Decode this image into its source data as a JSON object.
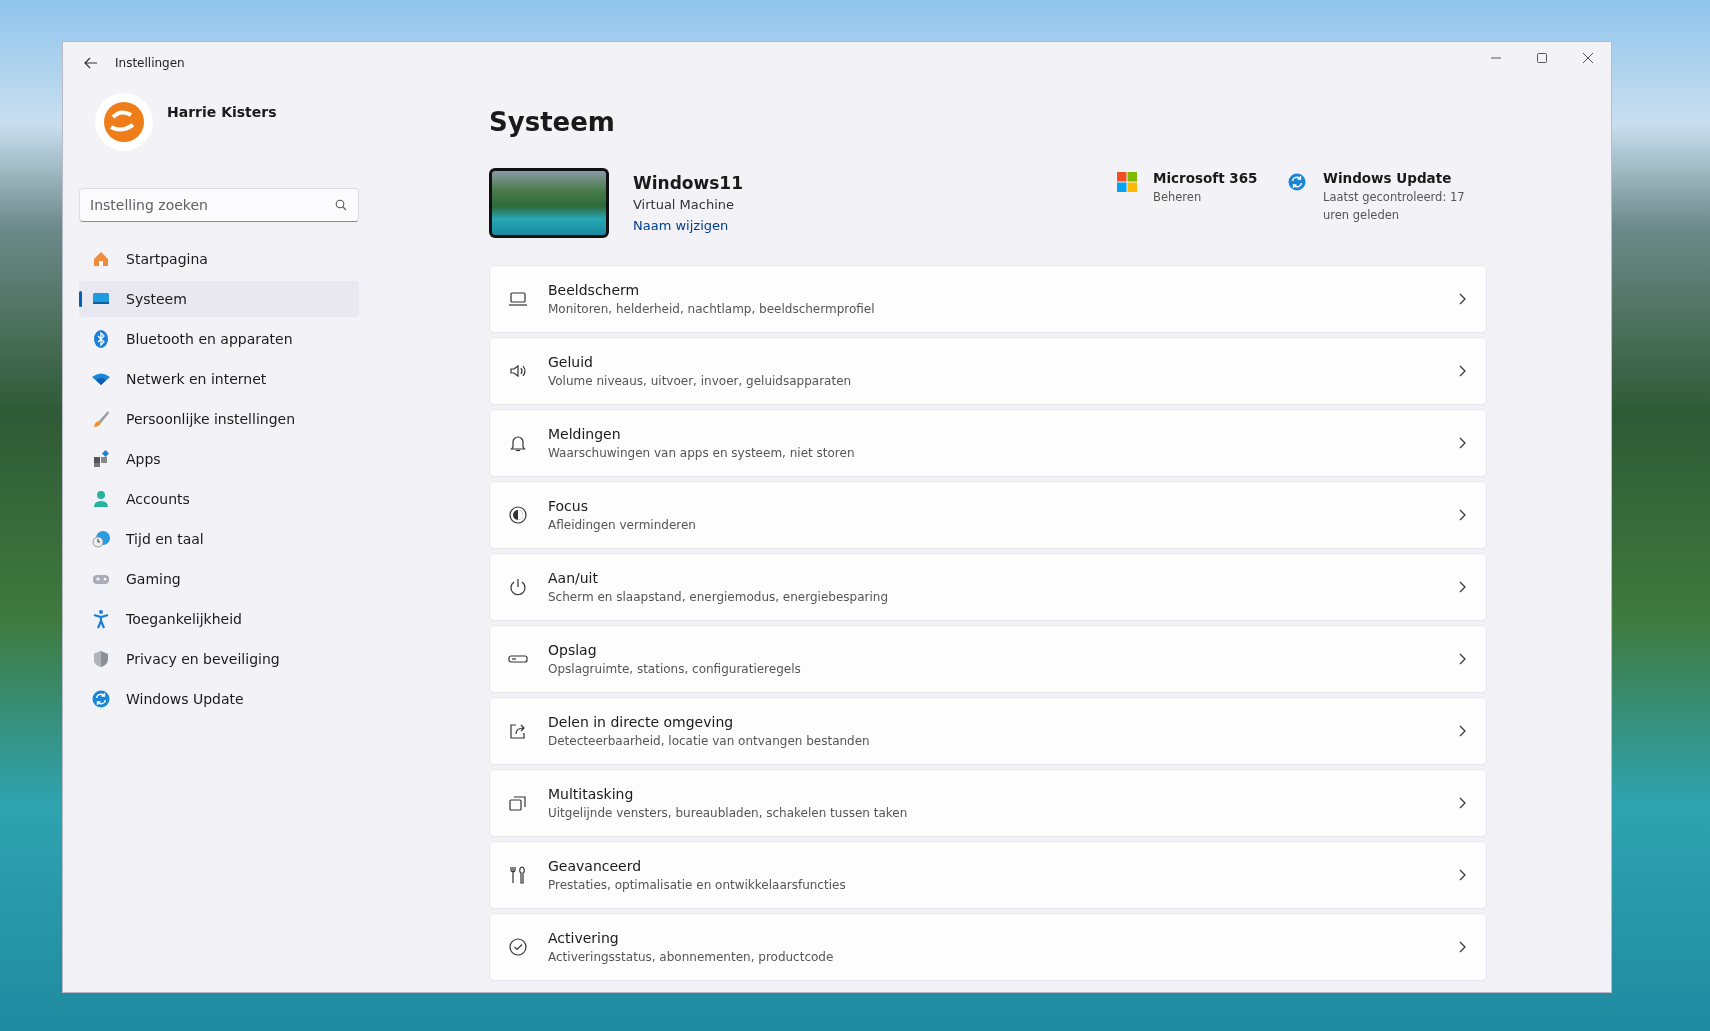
{
  "window": {
    "title": "Instellingen"
  },
  "profile": {
    "name": "Harrie Kisters"
  },
  "search": {
    "placeholder": "Instelling zoeken"
  },
  "sidebar": {
    "items": [
      {
        "label": "Startpagina",
        "selected": false
      },
      {
        "label": "Systeem",
        "selected": true
      },
      {
        "label": "Bluetooth en apparaten",
        "selected": false
      },
      {
        "label": "Netwerk en internet",
        "selected": false
      },
      {
        "label": "Persoonlijke instellingen",
        "selected": false
      },
      {
        "label": "Apps",
        "selected": false
      },
      {
        "label": "Accounts",
        "selected": false
      },
      {
        "label": "Tijd en taal",
        "selected": false
      },
      {
        "label": "Gaming",
        "selected": false
      },
      {
        "label": "Toegankelijkheid",
        "selected": false
      },
      {
        "label": "Privacy en beveiliging",
        "selected": false
      },
      {
        "label": "Windows Update",
        "selected": false
      }
    ]
  },
  "page": {
    "title": "Systeem"
  },
  "device": {
    "name": "Windows11",
    "type": "Virtual Machine",
    "rename_link": "Naam wijzigen"
  },
  "quick_links": [
    {
      "title": "Microsoft 365",
      "subtitle": "Beheren"
    },
    {
      "title": "Windows Update",
      "subtitle": "Laatst gecontroleerd: 17 uren geleden"
    }
  ],
  "settings": [
    {
      "title": "Beeldscherm",
      "description": "Monitoren, helderheid, nachtlamp, beeldschermprofiel"
    },
    {
      "title": "Geluid",
      "description": "Volume niveaus, uitvoer, invoer, geluidsapparaten"
    },
    {
      "title": "Meldingen",
      "description": "Waarschuwingen van apps en systeem, niet storen"
    },
    {
      "title": "Focus",
      "description": "Afleidingen verminderen"
    },
    {
      "title": "Aan/uit",
      "description": "Scherm en slaapstand, energiemodus, energiebesparing"
    },
    {
      "title": "Opslag",
      "description": "Opslagruimte, stations, configuratieregels"
    },
    {
      "title": "Delen in directe omgeving",
      "description": "Detecteerbaarheid, locatie van ontvangen bestanden"
    },
    {
      "title": "Multitasking",
      "description": "Uitgelijnde vensters, bureaubladen, schakelen tussen taken"
    },
    {
      "title": "Geavanceerd",
      "description": "Prestaties, optimalisatie en ontwikkelaarsfuncties"
    },
    {
      "title": "Activering",
      "description": "Activeringsstatus, abonnementen, productcode"
    }
  ]
}
